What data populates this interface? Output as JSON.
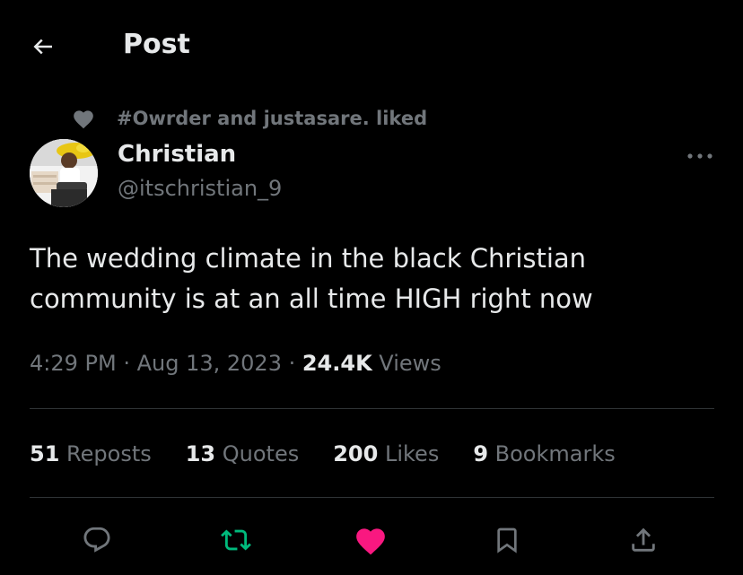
{
  "header": {
    "title": "Post"
  },
  "social_context": {
    "text": "#Owrder and justasare. liked"
  },
  "author": {
    "name": "Christian",
    "handle": "@itschristian_9"
  },
  "tweet": {
    "text_line1": "The wedding climate in the black Christian",
    "text_line2": "community is at an all time HIGH right now"
  },
  "meta": {
    "time": "4:29 PM",
    "sep1": " · ",
    "date": "Aug 13, 2023",
    "sep2": " · ",
    "views_count": "24.4K",
    "views_label": " Views"
  },
  "stats": {
    "reposts_count": "51",
    "reposts_label": " Reposts",
    "quotes_count": "13",
    "quotes_label": " Quotes",
    "likes_count": "200",
    "likes_label": " Likes",
    "bookmarks_count": "9",
    "bookmarks_label": " Bookmarks"
  },
  "icons": {
    "back": "arrow-left-icon",
    "context": "heart-icon",
    "more": "more-icon",
    "reply": "reply-icon",
    "repost": "repost-icon",
    "like": "heart-filled-icon",
    "bookmark": "bookmark-icon",
    "share": "share-icon"
  },
  "colors": {
    "background": "#000000",
    "text_primary": "#e7e9ea",
    "text_secondary": "#71767b",
    "divider": "#2f3336",
    "repost_active": "#00ba7c",
    "like_active": "#f91880"
  }
}
